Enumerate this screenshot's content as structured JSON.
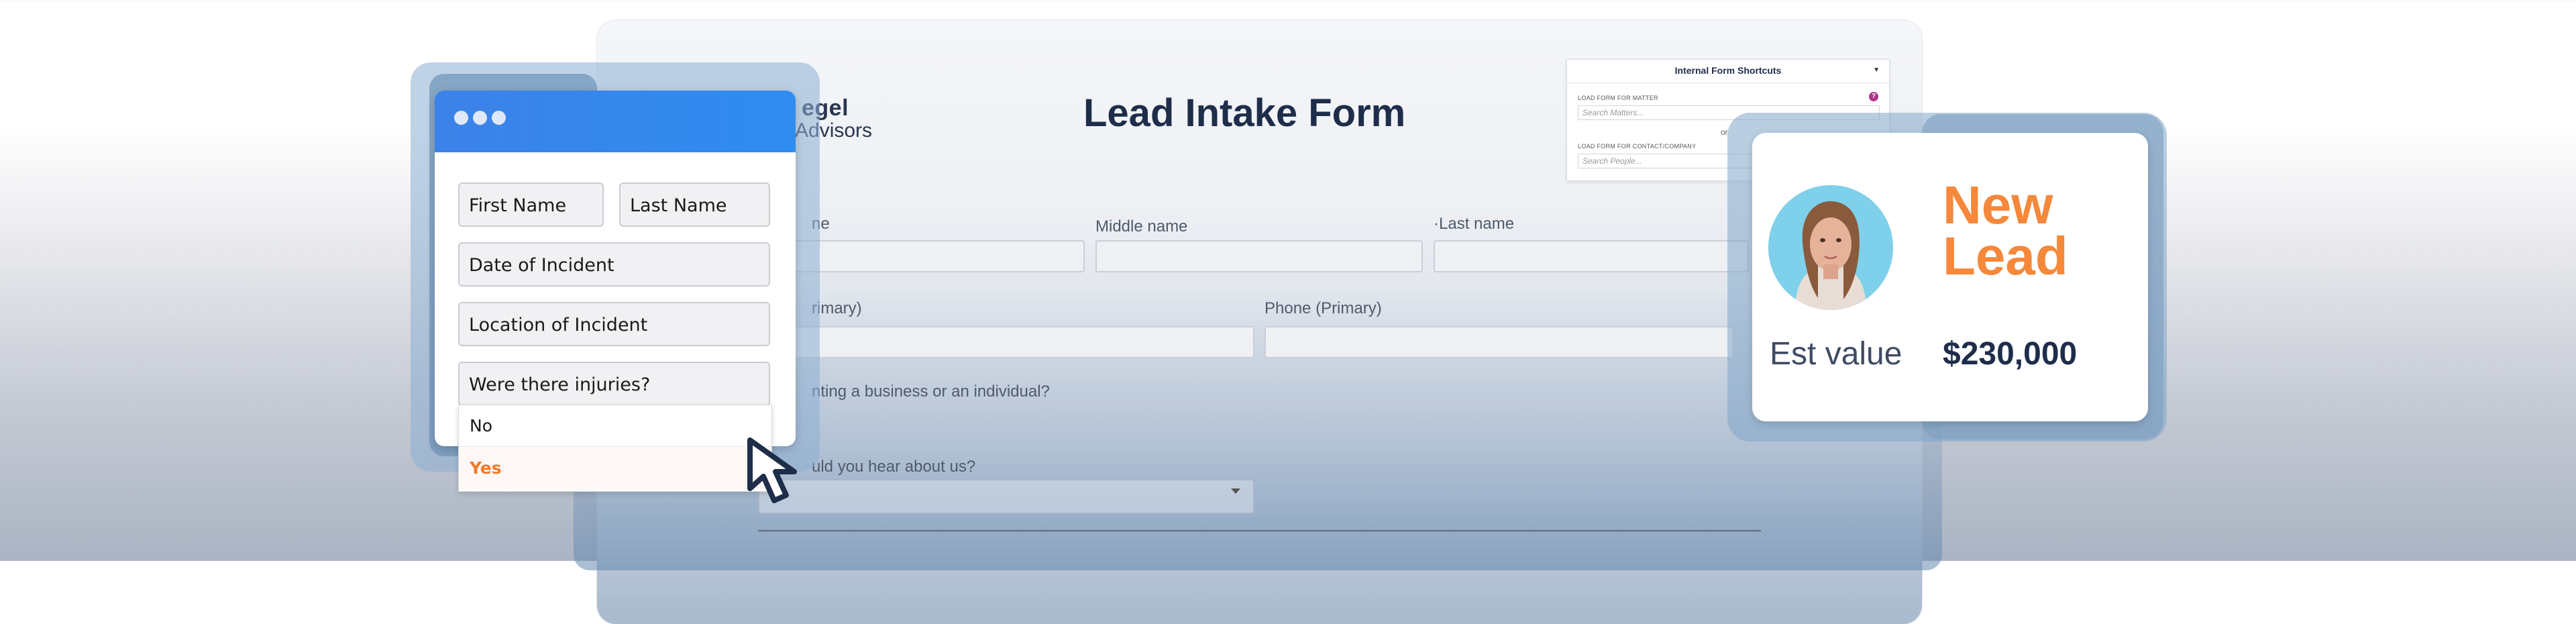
{
  "form": {
    "logo_line1": "egel",
    "logo_line2": "Advisors",
    "title": "Lead Intake Form",
    "fields": {
      "first_name_label": "ne",
      "middle_name_label": "Middle name",
      "last_name_label": "·Last name",
      "email_label": "rimary)",
      "phone_label": "Phone (Primary)",
      "business_question": "nting a business or an individual?",
      "hear_about_question": "uld you hear about us?"
    }
  },
  "shortcuts": {
    "title": "Internal Form Shortcuts",
    "matter_label": "LOAD FORM FOR MATTER",
    "matter_placeholder": "Search Matters...",
    "or_text": "or",
    "contact_label": "LOAD FORM FOR CONTACT/COMPANY",
    "contact_placeholder": "Search People..."
  },
  "intake_window": {
    "fields": {
      "first_name": "First Name",
      "last_name": "Last Name",
      "date_of_incident": "Date of Incident",
      "location_of_incident": "Location of Incident",
      "injuries_question": "Were there injuries?"
    },
    "dropdown_options": [
      "No",
      "Yes"
    ],
    "selected_option": "Yes"
  },
  "lead_card": {
    "title_line1": "New",
    "title_line2": "Lead",
    "est_label": "Est value",
    "est_value": "$230,000"
  },
  "colors": {
    "accent_orange": "#f5883a",
    "window_bar_blue": "#3c82e8",
    "title_navy": "#1e2d4a",
    "help_badge": "#b0358a"
  }
}
